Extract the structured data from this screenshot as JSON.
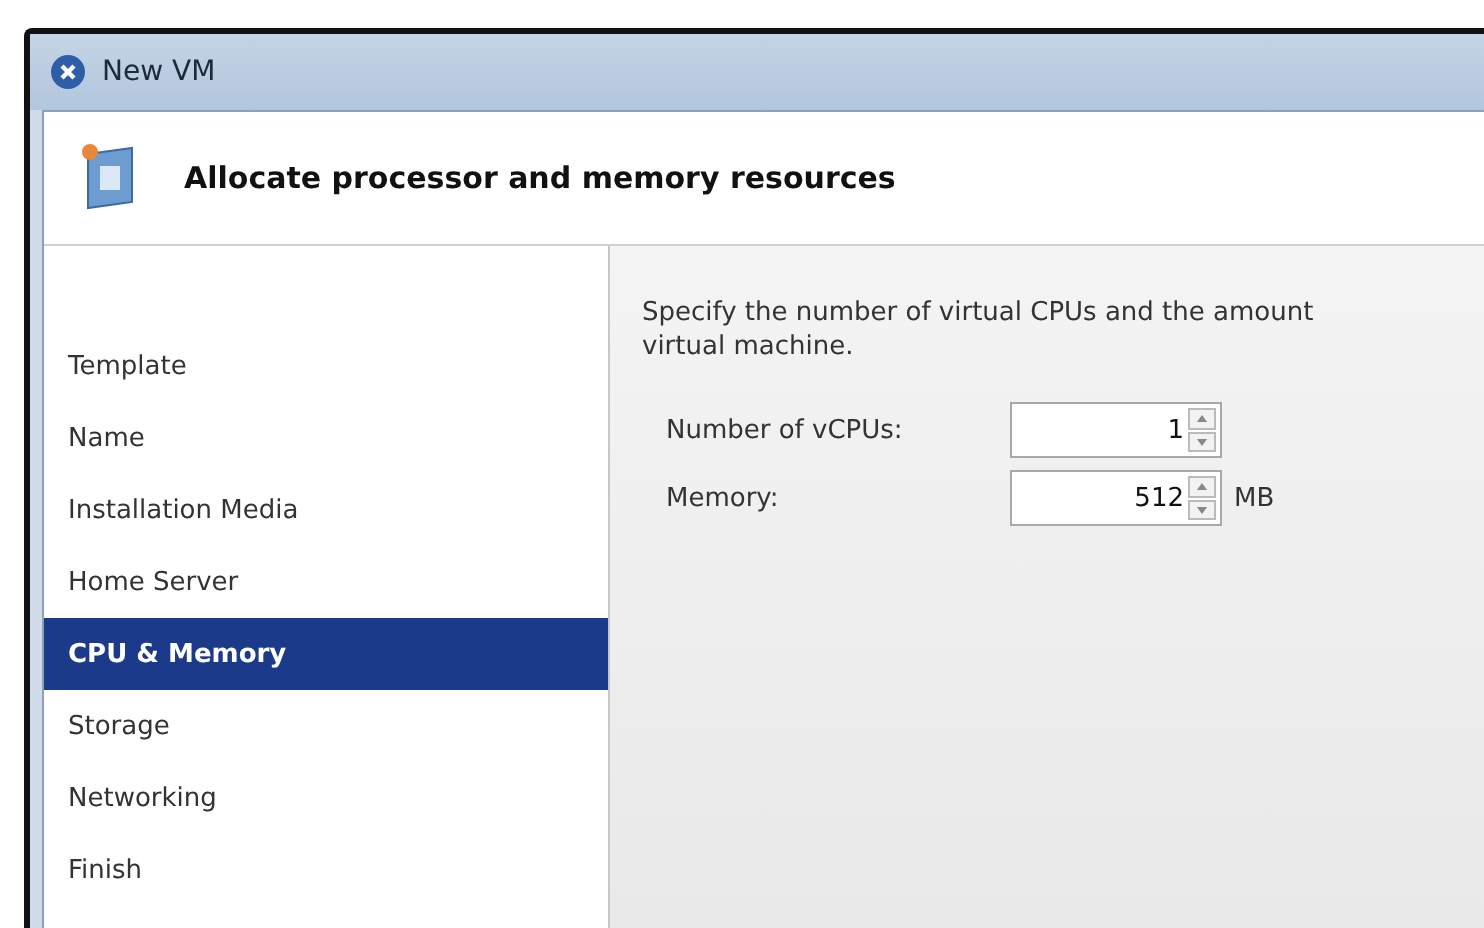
{
  "window": {
    "title": "New VM"
  },
  "header": {
    "title": "Allocate processor and memory resources"
  },
  "sidebar": {
    "items": [
      {
        "label": "Template",
        "selected": false
      },
      {
        "label": "Name",
        "selected": false
      },
      {
        "label": "Installation Media",
        "selected": false
      },
      {
        "label": "Home Server",
        "selected": false
      },
      {
        "label": "CPU & Memory",
        "selected": true
      },
      {
        "label": "Storage",
        "selected": false
      },
      {
        "label": "Networking",
        "selected": false
      },
      {
        "label": "Finish",
        "selected": false
      }
    ]
  },
  "content": {
    "description": "Specify the number of virtual CPUs and the amount\nvirtual machine.",
    "fields": [
      {
        "label": "Number of vCPUs:",
        "value": "1"
      },
      {
        "label": "Memory:",
        "value": "512",
        "unit": "MB"
      }
    ]
  }
}
